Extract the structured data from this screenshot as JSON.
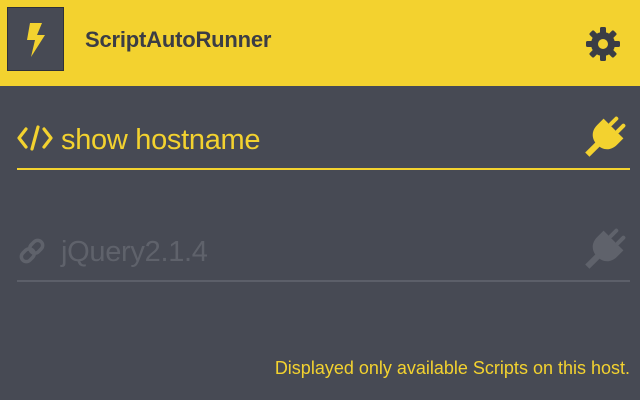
{
  "app": {
    "title": "ScriptAutoRunner",
    "logo_icon": "lightning-bolt-icon",
    "settings_icon": "gear-icon"
  },
  "colors": {
    "accent": "#f3d22f",
    "background": "#474a54",
    "muted": "#5f626b"
  },
  "scripts": [
    {
      "name": "show hostname",
      "type_icon": "code-icon",
      "enabled": true,
      "toggle_icon": "plug-icon"
    },
    {
      "name": "jQuery2.1.4",
      "type_icon": "link-icon",
      "enabled": false,
      "toggle_icon": "plug-icon"
    }
  ],
  "footer": {
    "note": "Displayed only available Scripts on this host."
  }
}
